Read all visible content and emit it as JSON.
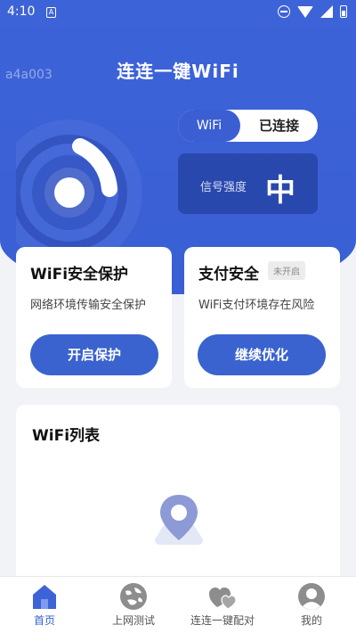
{
  "status_bar": {
    "time": "4:10",
    "app_icon_letter": "A"
  },
  "header": {
    "title": "连连一键WiFi",
    "watermark": "a4a003"
  },
  "connection": {
    "network_label": "WiFi",
    "status": "已连接"
  },
  "signal": {
    "label": "信号强度",
    "value": "中"
  },
  "cards": {
    "wifi_protect": {
      "title": "WiFi安全保护",
      "subtitle": "网络环境传输安全保护",
      "button": "开启保护"
    },
    "pay_secure": {
      "title": "支付安全",
      "badge": "未开启",
      "subtitle": "WiFi支付环境存在风险",
      "button": "继续优化"
    }
  },
  "wifi_list": {
    "title": "WiFi列表"
  },
  "tabbar": [
    {
      "label": "首页",
      "icon": "home-icon",
      "active": true
    },
    {
      "label": "上网测试",
      "icon": "speed-test-icon",
      "active": false
    },
    {
      "label": "连连一键配对",
      "icon": "hearts-icon",
      "active": false
    },
    {
      "label": "我的",
      "icon": "profile-icon",
      "active": false
    }
  ],
  "colors": {
    "primary": "#3a63cf",
    "hero": "#3d63d9",
    "background": "#f2f3f7"
  }
}
